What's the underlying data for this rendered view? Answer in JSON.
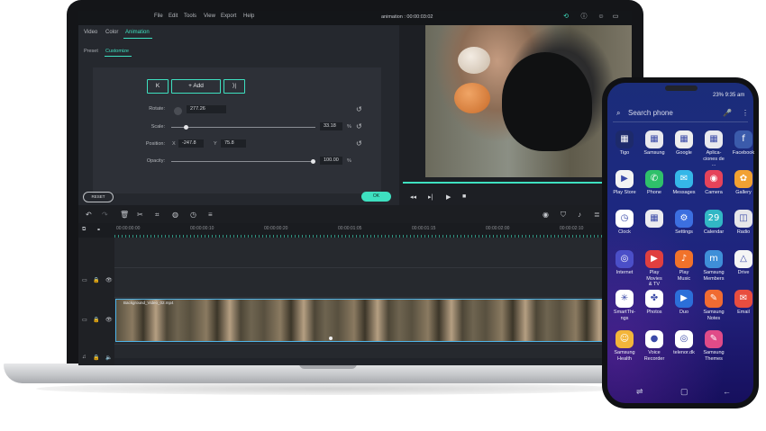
{
  "editor": {
    "menu": [
      "File",
      "Edit",
      "Tools",
      "View",
      "Export",
      "Help"
    ],
    "title": "animation : 00:00:03:02",
    "tabs": [
      "Video",
      "Color",
      "Animation"
    ],
    "subtabs": [
      "Preset",
      "Customize"
    ],
    "add_label": "+ Add",
    "rotate_label": "Rotate:",
    "rotate_value": "277.26",
    "scale_label": "Scale:",
    "scale_value": "33.18",
    "scale_unit": "%",
    "position_label": "Position:",
    "pos_x_label": "X",
    "pos_x_value": "-247.8",
    "pos_y_label": "Y",
    "pos_y_value": "75.8",
    "opacity_label": "Opacity:",
    "opacity_value": "100.00",
    "opacity_unit": "%",
    "reset_label": "RESET",
    "ok_label": "OK",
    "timecodes": [
      "00:00:00:00",
      "00:00:00:10",
      "00:00:00:20",
      "00:00:01:05",
      "00:00:01:15",
      "00:00:02:00",
      "00:00:02:10"
    ],
    "clip_title": "Background_Video_02.mp4",
    "scale_fraction": 0.1,
    "opacity_fraction": 1.0,
    "accent_color": "#3ee0c0"
  },
  "phone": {
    "status": "23% 9:35 am",
    "search_placeholder": "Search phone",
    "apps": [
      {
        "label": "Tigo",
        "icon": "tigo-icon",
        "color": "#1d2a6b",
        "glyph": "▦"
      },
      {
        "label": "Samsung",
        "icon": "samsung-folder-icon",
        "color": "#e9e9ee",
        "glyph": "▦"
      },
      {
        "label": "Google",
        "icon": "google-folder-icon",
        "color": "#eeeeee",
        "glyph": "▦"
      },
      {
        "label": "Aplica-\nciones de ...",
        "icon": "apps-folder-icon",
        "color": "#e9e9ee",
        "glyph": "▦"
      },
      {
        "label": "Facebook",
        "icon": "facebook-icon",
        "color": "#3b5bab",
        "glyph": "f"
      },
      {
        "label": "Play Store",
        "icon": "play-store-icon",
        "color": "#f3f3f3",
        "glyph": "▶"
      },
      {
        "label": "Phone",
        "icon": "phone-icon",
        "color": "#2fc06a",
        "glyph": "✆"
      },
      {
        "label": "Messages",
        "icon": "messages-icon",
        "color": "#35b7e8",
        "glyph": "✉"
      },
      {
        "label": "Camera",
        "icon": "camera-icon",
        "color": "#e5435a",
        "glyph": "◉"
      },
      {
        "label": "Gallery",
        "icon": "gallery-icon",
        "color": "#f2a132",
        "glyph": "✿"
      },
      {
        "label": "Clock",
        "icon": "clock-icon",
        "color": "#ffffff",
        "glyph": "◷"
      },
      {
        "label": "",
        "icon": "blank-folder-icon",
        "color": "#ececf0",
        "glyph": "▦"
      },
      {
        "label": "Settings",
        "icon": "settings-icon",
        "color": "#3c6fe0",
        "glyph": "⚙"
      },
      {
        "label": "Calendar",
        "icon": "calendar-icon",
        "color": "#32b7c5",
        "glyph": "29"
      },
      {
        "label": "Radio",
        "icon": "radio-icon",
        "color": "#e6e6ea",
        "glyph": "◫"
      },
      {
        "label": "Internet",
        "icon": "internet-icon",
        "color": "#4b4fc8",
        "glyph": "◎"
      },
      {
        "label": "Play Movies\n& TV",
        "icon": "play-movies-icon",
        "color": "#e03f3f",
        "glyph": "▶"
      },
      {
        "label": "Play Music",
        "icon": "play-music-icon",
        "color": "#f1722a",
        "glyph": "♪"
      },
      {
        "label": "Samsung\nMembers",
        "icon": "samsung-members-icon",
        "color": "#3f8fd8",
        "glyph": "m"
      },
      {
        "label": "Drive",
        "icon": "drive-icon",
        "color": "#f5f5f5",
        "glyph": "△"
      },
      {
        "label": "SmartThi-\nngs",
        "icon": "smartthings-icon",
        "color": "#ffffff",
        "glyph": "✳"
      },
      {
        "label": "Photos",
        "icon": "photos-icon",
        "color": "#ffffff",
        "glyph": "✤"
      },
      {
        "label": "Duo",
        "icon": "duo-icon",
        "color": "#2c6fd9",
        "glyph": "▶"
      },
      {
        "label": "Samsung\nNotes",
        "icon": "samsung-notes-icon",
        "color": "#f06b32",
        "glyph": "✎"
      },
      {
        "label": "Email",
        "icon": "email-icon",
        "color": "#e84d3f",
        "glyph": "✉"
      },
      {
        "label": "Samsung\nHealth",
        "icon": "samsung-health-icon",
        "color": "#f3b53a",
        "glyph": "☺"
      },
      {
        "label": "Voice\nRecorder",
        "icon": "voice-recorder-icon",
        "color": "#ffffff",
        "glyph": "●"
      },
      {
        "label": "telenor.dk",
        "icon": "telenor-icon",
        "color": "#ffffff",
        "glyph": "◎"
      },
      {
        "label": "Samsung\nThemes",
        "icon": "samsung-themes-icon",
        "color": "#e04b88",
        "glyph": "✎"
      }
    ]
  }
}
